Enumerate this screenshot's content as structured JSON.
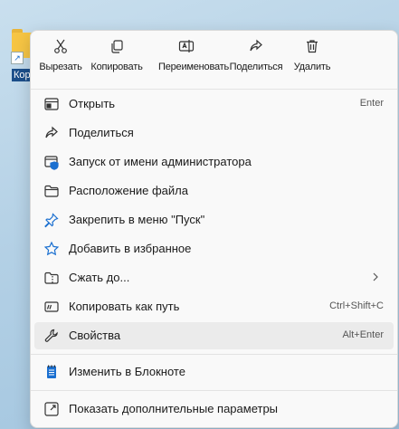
{
  "desktop": {
    "shortcut_label": "Кор"
  },
  "quick_actions": [
    {
      "label": "Вырезать",
      "icon": "cut-icon"
    },
    {
      "label": "Копировать",
      "icon": "copy-icon"
    },
    {
      "label": "Переименовать",
      "icon": "rename-icon"
    },
    {
      "label": "Поделиться",
      "icon": "share-icon"
    },
    {
      "label": "Удалить",
      "icon": "delete-icon"
    }
  ],
  "menu_items": [
    {
      "label": "Открыть",
      "shortcut": "Enter",
      "icon": "open-icon"
    },
    {
      "label": "Поделиться",
      "shortcut": "",
      "icon": "share-icon"
    },
    {
      "label": "Запуск от имени администратора",
      "shortcut": "",
      "icon": "run-as-admin-icon"
    },
    {
      "label": "Расположение файла",
      "shortcut": "",
      "icon": "folder-icon"
    },
    {
      "label": "Закрепить в меню \"Пуск\"",
      "shortcut": "",
      "icon": "pin-icon"
    },
    {
      "label": "Добавить в избранное",
      "shortcut": "",
      "icon": "star-icon"
    },
    {
      "label": "Сжать до...",
      "shortcut": "",
      "icon": "zip-folder-icon",
      "submenu": true
    },
    {
      "label": "Копировать как путь",
      "shortcut": "Ctrl+Shift+C",
      "icon": "copy-path-icon"
    },
    {
      "label": "Свойства",
      "shortcut": "Alt+Enter",
      "icon": "wrench-icon",
      "hovered": true
    },
    {
      "label": "Изменить в Блокноте",
      "shortcut": "",
      "icon": "notepad-icon"
    },
    {
      "label": "Показать дополнительные параметры",
      "shortcut": "",
      "icon": "more-options-icon"
    }
  ],
  "colors": {
    "accent": "#1a6fd0",
    "menu_bg": "#f9f9f9",
    "hover_bg": "#ebebeb"
  }
}
